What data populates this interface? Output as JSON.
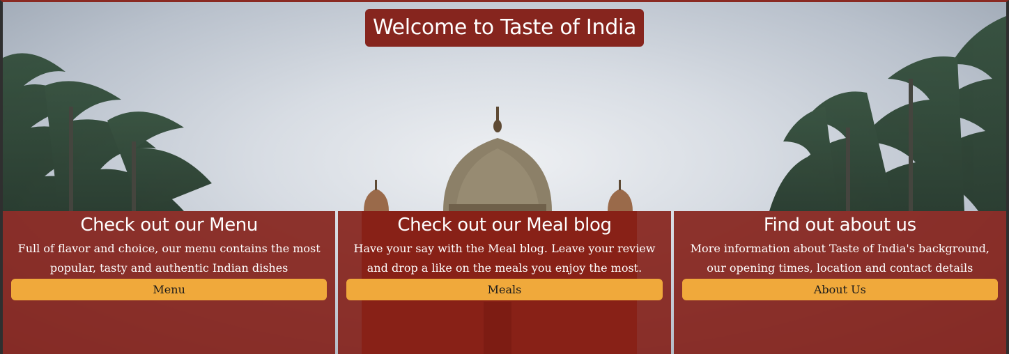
{
  "hero": {
    "title": "Welcome to Taste of India"
  },
  "cards": [
    {
      "title": "Check out our Menu",
      "text": "Full of flavor and choice, our menu contains the most popular, tasty and authentic Indian dishes",
      "button": "Menu"
    },
    {
      "title": "Check out our Meal blog",
      "text": "Have your say with the Meal blog. Leave your review and drop a like on the meals you enjoy the most.",
      "button": "Meals"
    },
    {
      "title": "Find out about us",
      "text": "More information about Taste of India's background, our opening times, location and contact details",
      "button": "About Us"
    }
  ],
  "colors": {
    "brand_red": "#86251e",
    "button_orange": "#f0a93b"
  }
}
